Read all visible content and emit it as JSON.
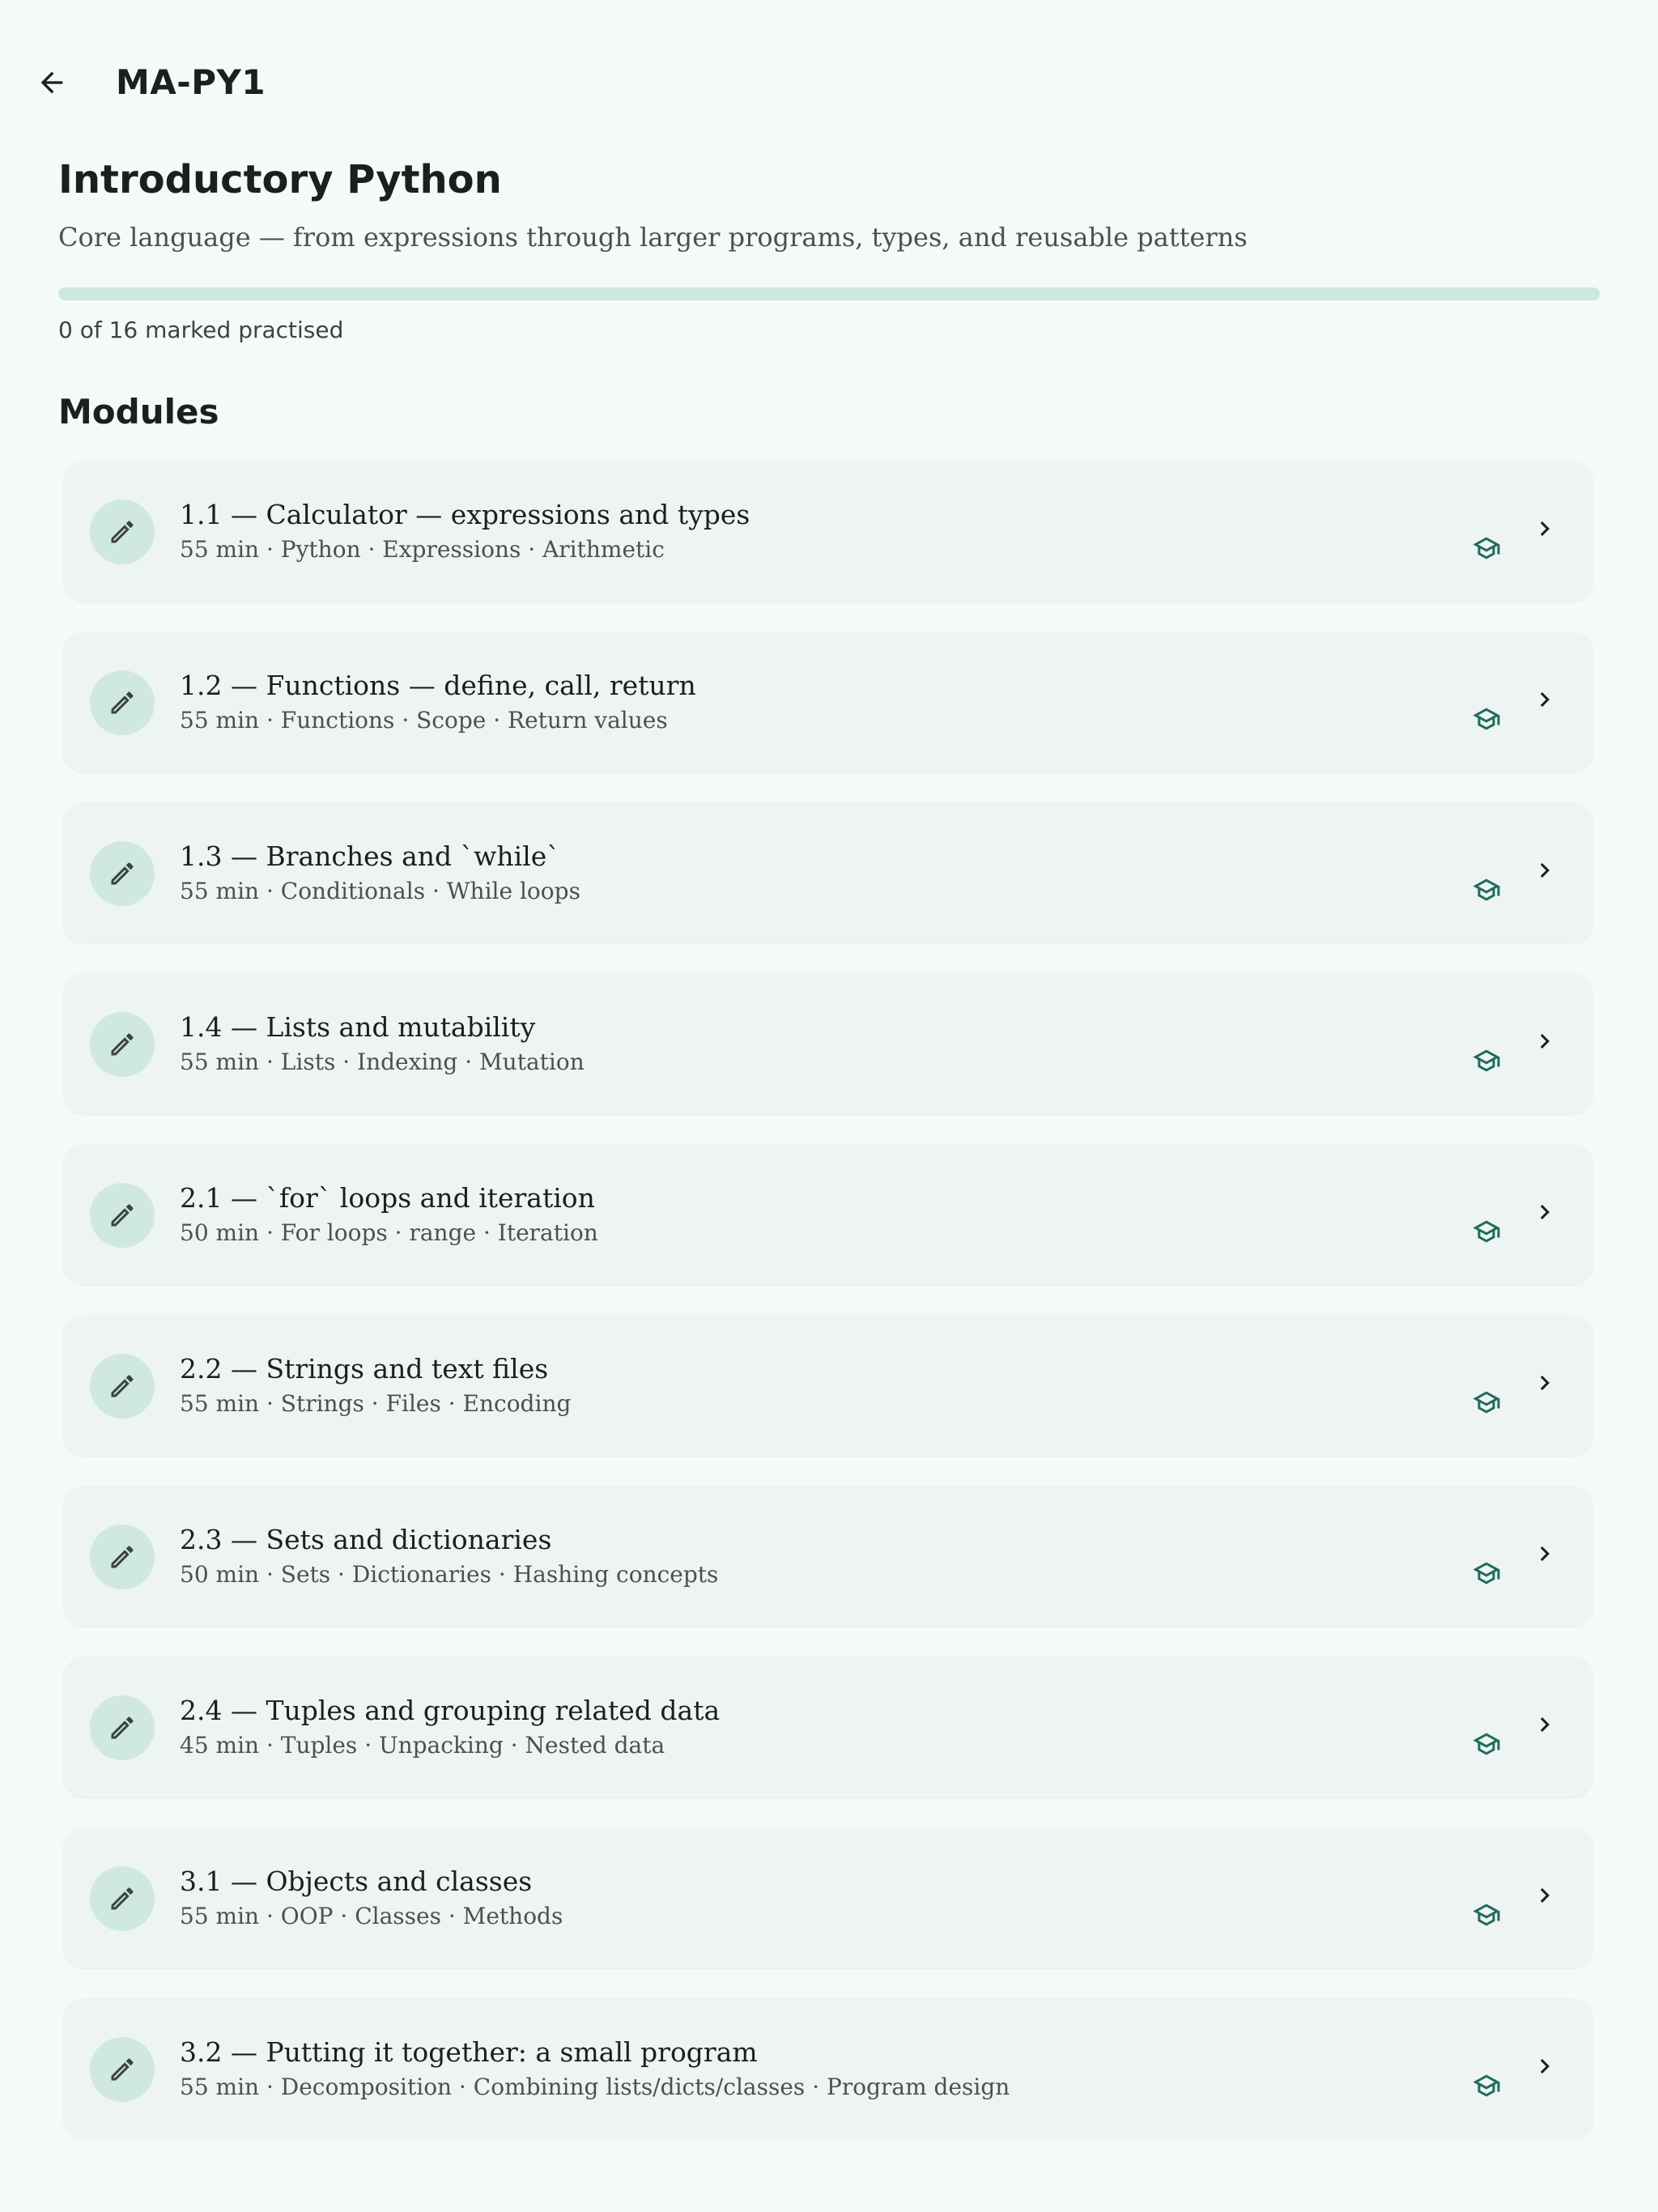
{
  "topbar": {
    "back_icon": "arrow-back-icon",
    "title": "MA-PY1"
  },
  "course": {
    "title": "Introductory Python",
    "subtitle": "Core language — from expressions through larger programs, types, and reusable patterns",
    "progress_fraction": 0,
    "progress_text": "0 of 16 marked practised"
  },
  "section": {
    "heading": "Modules"
  },
  "colors": {
    "background": "#f4faf8",
    "card": "#eef4f2",
    "icon_circle": "#cfe8e2",
    "accent": "#1f6b5e",
    "progress_track": "#cde7e1"
  },
  "icons": {
    "module": "pencil-icon",
    "practise": "graduation-cap-icon",
    "open": "chevron-right-icon"
  },
  "modules": [
    {
      "title": "1.1 — Calculator — expressions and types",
      "meta": "55 min · Python · Expressions · Arithmetic"
    },
    {
      "title": "1.2 — Functions — define, call, return",
      "meta": "55 min · Functions · Scope · Return values"
    },
    {
      "title": "1.3 — Branches and `while`",
      "meta": "55 min · Conditionals · While loops"
    },
    {
      "title": "1.4 — Lists and mutability",
      "meta": "55 min · Lists · Indexing · Mutation"
    },
    {
      "title": "2.1 — `for` loops and iteration",
      "meta": "50 min · For loops · range · Iteration"
    },
    {
      "title": "2.2 — Strings and text files",
      "meta": "55 min · Strings · Files · Encoding"
    },
    {
      "title": "2.3 — Sets and dictionaries",
      "meta": "50 min · Sets · Dictionaries · Hashing concepts"
    },
    {
      "title": "2.4 — Tuples and grouping related data",
      "meta": "45 min · Tuples · Unpacking · Nested data"
    },
    {
      "title": "3.1 — Objects and classes",
      "meta": "55 min · OOP · Classes · Methods"
    },
    {
      "title": "3.2 — Putting it together: a small program",
      "meta": "55 min · Decomposition · Combining lists/dicts/classes · Program design"
    }
  ]
}
